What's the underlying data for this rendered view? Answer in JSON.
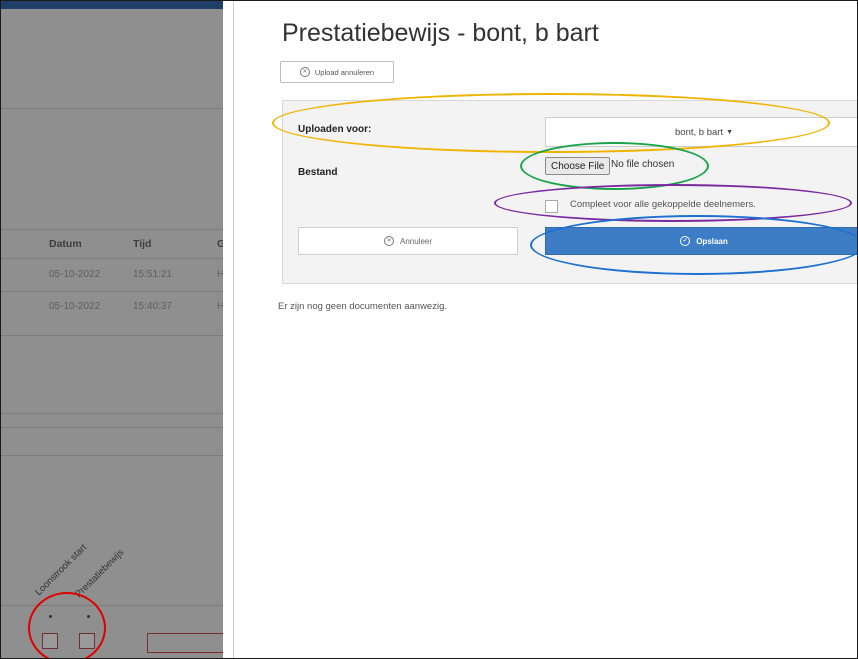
{
  "background_page": {
    "table_headers": [
      "Datum",
      "Tijd",
      "G"
    ],
    "rows": [
      {
        "date": "05-10-2022",
        "time": "15:51:21",
        "col3": "H"
      },
      {
        "date": "05-10-2022",
        "time": "15:40:37",
        "col3": "H"
      }
    ],
    "column_labels": [
      "Loonstrook start",
      "Prestatiebewijs"
    ]
  },
  "dialog": {
    "title": "Prestatiebewijs - bont, b bart",
    "cancel_upload_label": "Upload annuleren",
    "upload_for_label": "Uploaden voor:",
    "upload_for_value": "bont, b bart",
    "file_label": "Bestand",
    "choose_file_label": "Choose File",
    "no_file_text": "No file chosen",
    "complete_all_label": "Compleet voor alle gekoppelde deelnemers.",
    "cancel_label": "Annuleer",
    "save_label": "Opslaan",
    "no_documents_text": "Er zijn nog geen documenten aanwezig."
  },
  "icons": {
    "cancel_upload": "close-circle-icon",
    "cancel": "close-circle-icon",
    "save": "check-circle-icon",
    "dropdown": "caret-down-icon"
  },
  "colors": {
    "primary": "#3c7dc6",
    "annotation_yellow": "#f0b400",
    "annotation_green": "#1aa34a",
    "annotation_purple": "#7a2aa0",
    "annotation_blue": "#1d6fd0",
    "annotation_red": "#e00000"
  }
}
